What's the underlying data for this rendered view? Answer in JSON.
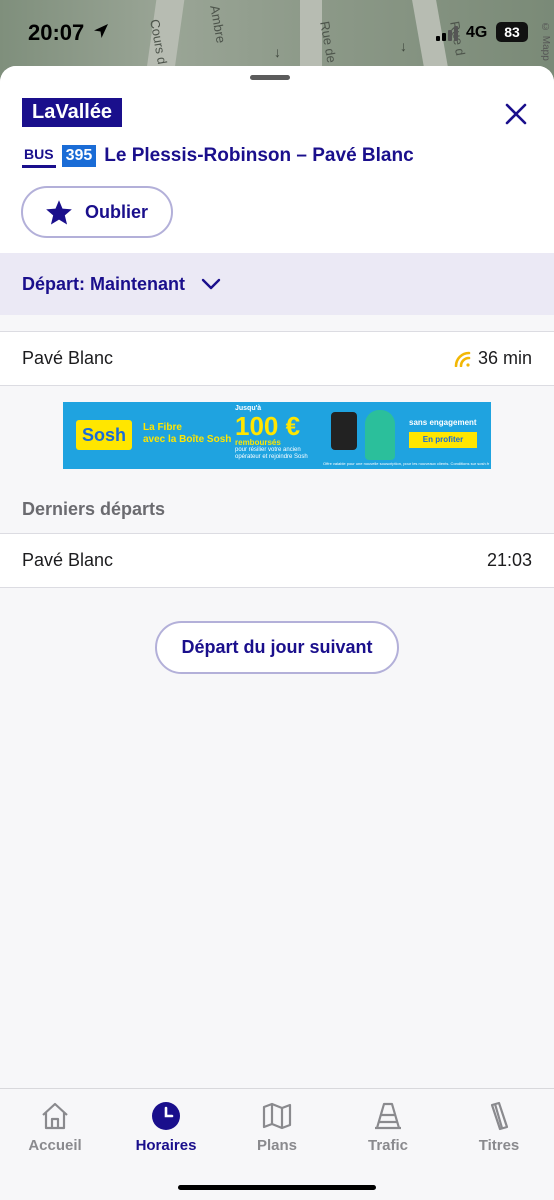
{
  "status_bar": {
    "time": "20:07",
    "network": "4G",
    "battery": "83",
    "map_credit": "© Mapp"
  },
  "map": {
    "streets": [
      "Cours d",
      "Ambre",
      "Rue de",
      "Rue d"
    ]
  },
  "header": {
    "brand": "LaVallée",
    "mode_tag": "BUS",
    "line_number": "395",
    "route_name": "Le Plessis-Robinson – Pavé Blanc",
    "forget_label": "Oublier"
  },
  "departure": {
    "label": "Départ: Maintenant"
  },
  "next_departures": [
    {
      "destination": "Pavé Blanc",
      "eta": "36 min",
      "realtime": true
    }
  ],
  "ad": {
    "brand": "Sosh",
    "tagline": "La Fibre\navec la Boîte Sosh",
    "upto": "Jusqu'à",
    "amount": "100 €",
    "refunded": "remboursés",
    "details": "pour résilier votre ancien opérateur et rejoindre Sosh",
    "no_commitment": "sans engagement",
    "cta": "En profiter",
    "legal": "Offre valable pour une nouvelle souscription, pour les nouveaux clients. Conditions sur sosh.fr"
  },
  "last_departures": {
    "title": "Derniers départs",
    "items": [
      {
        "destination": "Pavé Blanc",
        "time": "21:03"
      }
    ]
  },
  "next_day_label": "Départ du jour suivant",
  "tabs": [
    {
      "label": "Accueil",
      "icon": "home-icon",
      "active": false
    },
    {
      "label": "Horaires",
      "icon": "clock-icon",
      "active": true
    },
    {
      "label": "Plans",
      "icon": "map-icon",
      "active": false
    },
    {
      "label": "Trafic",
      "icon": "traffic-cone-icon",
      "active": false
    },
    {
      "label": "Titres",
      "icon": "ticket-icon",
      "active": false
    }
  ],
  "colors": {
    "brand": "#1a0f8c",
    "line": "#1a6cd6",
    "realtime": "#f2b705",
    "active_tab": "#1a0f8c",
    "inactive_tab": "#8a8a8e"
  }
}
